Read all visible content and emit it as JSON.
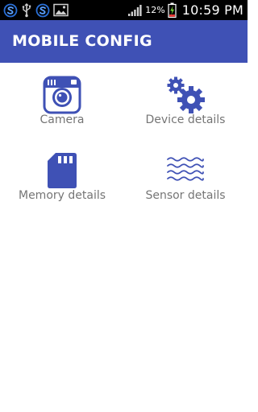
{
  "status_bar": {
    "battery_percent": "12%",
    "time": "10:59 PM",
    "left_icons": [
      "s-notification-icon",
      "usb-icon",
      "s-notification-icon",
      "image-icon"
    ],
    "right_icons": [
      "signal-icon",
      "battery-charging-icon"
    ]
  },
  "app_bar": {
    "title": "MOBILE CONFIG",
    "color": "#3f51b5"
  },
  "tiles": [
    {
      "label": "Camera",
      "icon": "camera-icon"
    },
    {
      "label": "Device details",
      "icon": "gears-icon"
    },
    {
      "label": "Memory details",
      "icon": "sd-card-icon"
    },
    {
      "label": "Sensor details",
      "icon": "waves-icon"
    }
  ],
  "colors": {
    "accent": "#3f51b5",
    "label_text": "#757575",
    "status_bar": "#000000"
  }
}
